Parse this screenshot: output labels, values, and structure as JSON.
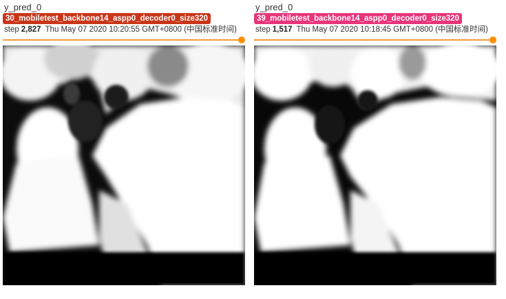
{
  "cards": [
    {
      "tag": "y_pred_0",
      "run_name": "30_mobiletest_backbone14_aspp0_decoder0_size320",
      "run_color": "#c8361a",
      "step_label": "step",
      "step_value": "2,827",
      "timestamp": "Thu May 07 2020 10:20:55 GMT+0800 (中国标准时间)",
      "image_icon": "grayscale-segmentation-mask"
    },
    {
      "tag": "y_pred_0",
      "run_name": "39_mobiletest_backbone14_aspp0_decoder0_size320",
      "run_color": "#e8357a",
      "step_label": "step",
      "step_value": "1,517",
      "timestamp": "Thu May 07 2020 10:18:45 GMT+0800 (中国标准时间)",
      "image_icon": "grayscale-segmentation-mask"
    }
  ],
  "slider_color": "#ff8f00"
}
